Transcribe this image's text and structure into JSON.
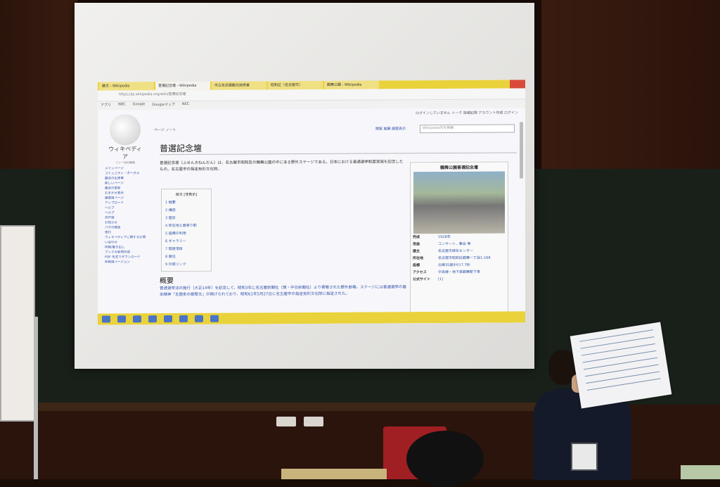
{
  "browser": {
    "tabs": [
      "論文 - Wikipedia",
      "普選記念壇 - Wikipedia",
      "市立名古屋観光技術者",
      "昭和区（名古屋市）",
      "鶴舞公園 - Wikipedia"
    ],
    "address": "https://ja.wikipedia.org/wiki/普選記念壇",
    "bookmarks": [
      "アプリ",
      "NBC",
      "Google",
      "Googleマップ",
      "NEC"
    ]
  },
  "wiki": {
    "top_links": "ログインしていません トーク 投稿記録 アカウント作成 ログイン",
    "logo_text": "ウィキペディア",
    "logo_sub": "フリー百科事典",
    "page_tabs": "ページ ノート",
    "view_tabs": "閲覧 編集 履歴表示",
    "search_placeholder": "Wikipedia内を検索",
    "title": "普選記念壇",
    "lead": "普選記念壇（ふせんきねんだん）は、名古屋市昭和区の鶴舞公園の中にある野外ステージである。日本における普通選挙制度実施を記念したもの。名古屋市の指定有形文化財。",
    "toc_title": "目次 [非表示]",
    "toc": [
      "1 概要",
      "2 構造",
      "3 歴史",
      "4 所在地と最寄り駅",
      "5 設備の利用",
      "6 ギャラリー",
      "7 関連項目",
      "8 脚注",
      "9 外部リンク"
    ],
    "section_title": "概要",
    "section_text": "普通選挙法の施行（大正14年）を記念して、昭和3年に名古屋新聞社（現・中日新聞社）より寄贈された野外劇場。ステージには普通選挙の基本精神「五箇条の御誓文」が掲げられており、昭和61年5月27日に名古屋市の指定有形文化財に指定された。",
    "sidenav": [
      "メインページ",
      "コミュニティ・ポータル",
      "最近の出来事",
      "新しいページ",
      "最近の更新",
      "おまかせ表示",
      "練習用ページ",
      "アップロード",
      "ヘルプ",
      "ヘルプ",
      "井戸端",
      "お知らせ",
      "バグの報告",
      "寄付",
      "ウィキペディアに関するお問い合わせ",
      "印刷/書き出し",
      "ブックの新規作成",
      "PDF 形式でダウンロード",
      "印刷用バージョン"
    ]
  },
  "infobox": {
    "title": "鶴舞公園普選記念壇",
    "rows": [
      {
        "k": "完成",
        "v": "1928年"
      },
      {
        "k": "用途",
        "v": "コンサート、集会 等"
      },
      {
        "k": "建主",
        "v": "名古屋市緑化センター"
      },
      {
        "k": "所在地",
        "v": "名古屋市昭和区鶴舞一丁目1-168"
      },
      {
        "k": "座標",
        "v": "北緯35度9分17.7秒"
      },
      {
        "k": "アクセス",
        "v": "中央線・地下鉄鶴舞駅下車"
      },
      {
        "k": "公式サイト",
        "v": "[1]"
      }
    ]
  }
}
